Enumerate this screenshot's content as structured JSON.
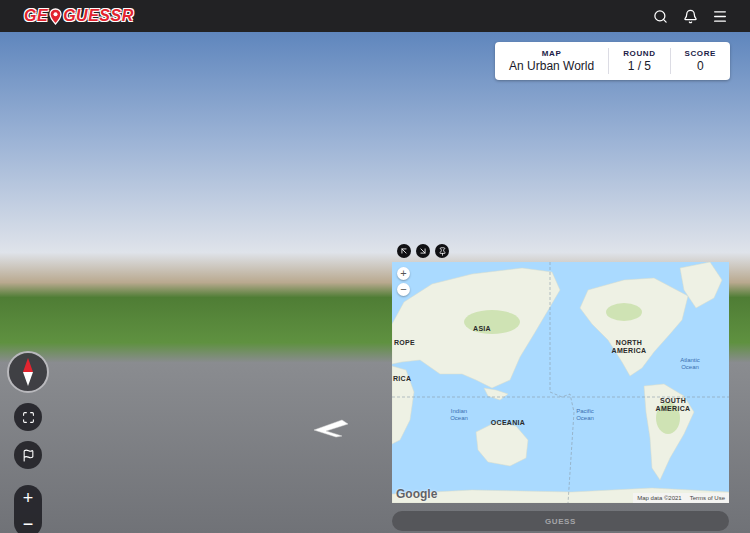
{
  "header": {
    "logo": {
      "left": "GE",
      "right": "GUESSR"
    }
  },
  "status": [
    {
      "label": "MAP",
      "value": "An Urban World"
    },
    {
      "label": "ROUND",
      "value": "1 / 5"
    },
    {
      "label": "SCORE",
      "value": "0"
    }
  ],
  "view_controls": {
    "zoom_in": "+",
    "zoom_out": "−"
  },
  "map": {
    "labels": [
      {
        "text": "ROPE",
        "kind": "continent"
      },
      {
        "text": "ASIA",
        "kind": "continent"
      },
      {
        "text": "RICA",
        "kind": "continent"
      },
      {
        "text": "NORTH AMERICA",
        "kind": "continent"
      },
      {
        "text": "Atlantic Ocean",
        "kind": "ocean"
      },
      {
        "text": "Indian Ocean",
        "kind": "ocean"
      },
      {
        "text": "OCEANIA",
        "kind": "continent"
      },
      {
        "text": "Pacific Ocean",
        "kind": "ocean"
      },
      {
        "text": "SOUTH AMERICA",
        "kind": "continent"
      }
    ],
    "zoom_in": "+",
    "zoom_out": "−",
    "logo": "Google",
    "attribution": "Map data ©2021",
    "terms": "Terms of Use"
  },
  "guess_button": {
    "label": "GUESS",
    "disabled": true
  }
}
